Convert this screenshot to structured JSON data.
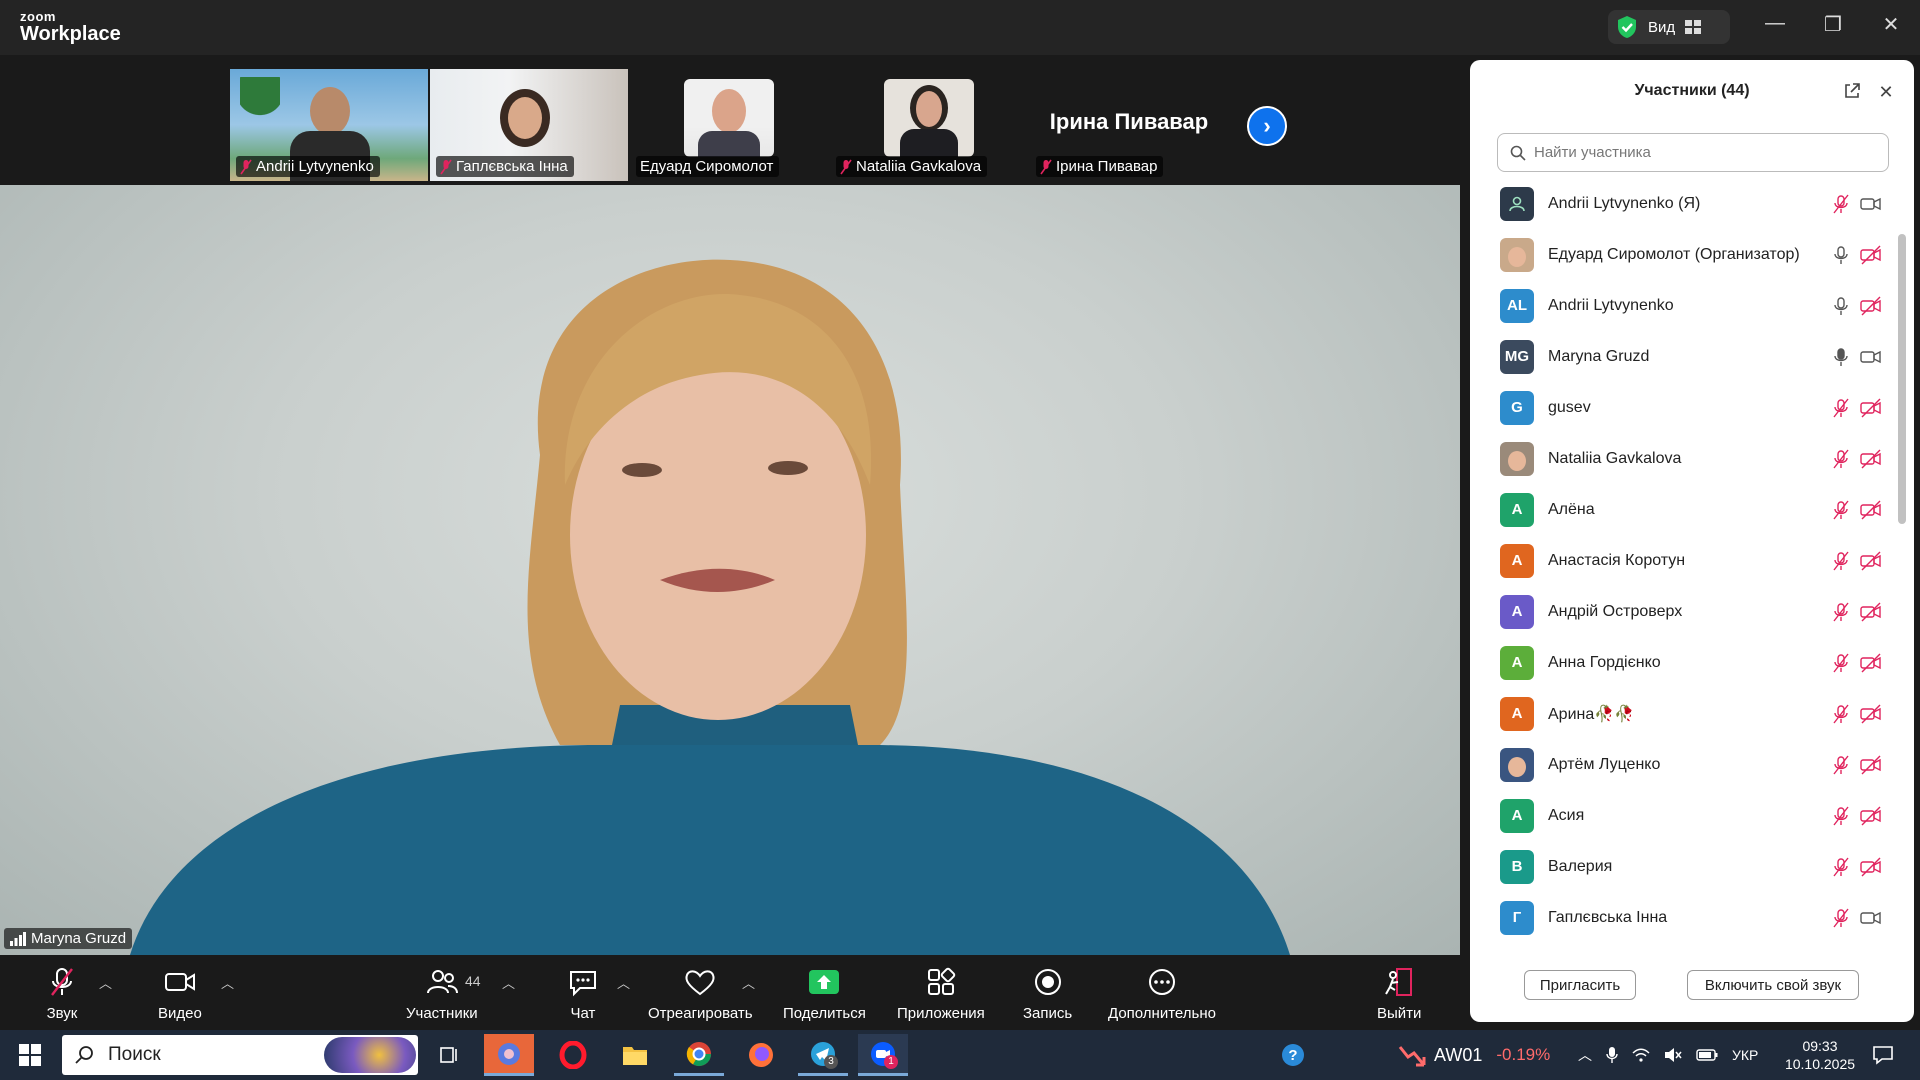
{
  "app": {
    "logo_top": "zoom",
    "logo_bottom": "Workplace",
    "view_label": "Вид"
  },
  "thumbnails": [
    {
      "name": "Andrii Lytvynenko",
      "muted": true,
      "kind": "beach"
    },
    {
      "name": "Гаплєвська Інна",
      "muted": true,
      "kind": "room"
    },
    {
      "name": "Едуард Сиромолот",
      "muted": false,
      "kind": "avatar"
    },
    {
      "name": "Nataliia Gavkalova",
      "muted": true,
      "kind": "avatar"
    },
    {
      "name": "Ірина Пивавар",
      "muted": true,
      "kind": "text",
      "big_name": "Ірина Пивавар"
    }
  ],
  "main_video": {
    "speaker_name": "Maryna Gruzd"
  },
  "panel": {
    "title": "Участники (44)",
    "search_placeholder": "Найти участника",
    "participants": [
      {
        "name": "Andrii Lytvynenko (Я)",
        "initials": "",
        "color": "#2d3a4a",
        "mic": "muted",
        "cam": "on"
      },
      {
        "name": "Едуард Сиромолот (Организатор)",
        "initials": "",
        "color": "#c9a98a",
        "mic": "on",
        "cam": "off"
      },
      {
        "name": "Andrii Lytvynenko",
        "initials": "AL",
        "color": "#2d8ccc",
        "mic": "on",
        "cam": "off"
      },
      {
        "name": "Maryna Gruzd",
        "initials": "MG",
        "color": "#3b4a5e",
        "mic": "active",
        "cam": "on"
      },
      {
        "name": "gusev",
        "initials": "G",
        "color": "#2d8ccc",
        "mic": "muted",
        "cam": "off"
      },
      {
        "name": "Nataliia Gavkalova",
        "initials": "",
        "color": "#9a8a7a",
        "mic": "muted",
        "cam": "off"
      },
      {
        "name": "Алёна",
        "initials": "А",
        "color": "#1fa36a",
        "mic": "muted",
        "cam": "off"
      },
      {
        "name": "Анастасія Коротун",
        "initials": "А",
        "color": "#e0661f",
        "mic": "muted",
        "cam": "off"
      },
      {
        "name": "Андрій Островерх",
        "initials": "А",
        "color": "#6a5ac8",
        "mic": "muted",
        "cam": "off"
      },
      {
        "name": "Анна Гордієнко",
        "initials": "А",
        "color": "#5cae3a",
        "mic": "muted",
        "cam": "off"
      },
      {
        "name": "Арина🥀🥀",
        "initials": "А",
        "color": "#e0661f",
        "mic": "muted",
        "cam": "off"
      },
      {
        "name": "Артём Луценко",
        "initials": "",
        "color": "#3a5580",
        "mic": "muted",
        "cam": "off"
      },
      {
        "name": "Асия",
        "initials": "А",
        "color": "#1fa36a",
        "mic": "muted",
        "cam": "off"
      },
      {
        "name": "Валерия",
        "initials": "В",
        "color": "#1a9a8a",
        "mic": "muted",
        "cam": "off"
      },
      {
        "name": "Гаплєвська Інна",
        "initials": "Г",
        "color": "#2d8ccc",
        "mic": "muted",
        "cam": "on"
      }
    ],
    "invite_label": "Пригласить",
    "unmute_label": "Включить свой звук"
  },
  "toolbar": {
    "audio": "Звук",
    "video": "Видео",
    "participants": "Участники",
    "participants_count": "44",
    "chat": "Чат",
    "react": "Отреагировать",
    "share": "Поделиться",
    "apps": "Приложения",
    "record": "Запись",
    "more": "Дополнительно",
    "leave": "Выйти"
  },
  "taskbar": {
    "search_label": "Поиск",
    "stock_name": "AW01",
    "stock_change": "-0.19%",
    "language": "УКР",
    "time": "09:33",
    "date": "10.10.2025",
    "telegram_badge": "3",
    "zoom_badge": "1"
  },
  "colors": {
    "accent": "#0e72ed",
    "share_green": "#22c55e",
    "muted_red": "#e0245e",
    "stock_red": "#ff6b6b"
  }
}
